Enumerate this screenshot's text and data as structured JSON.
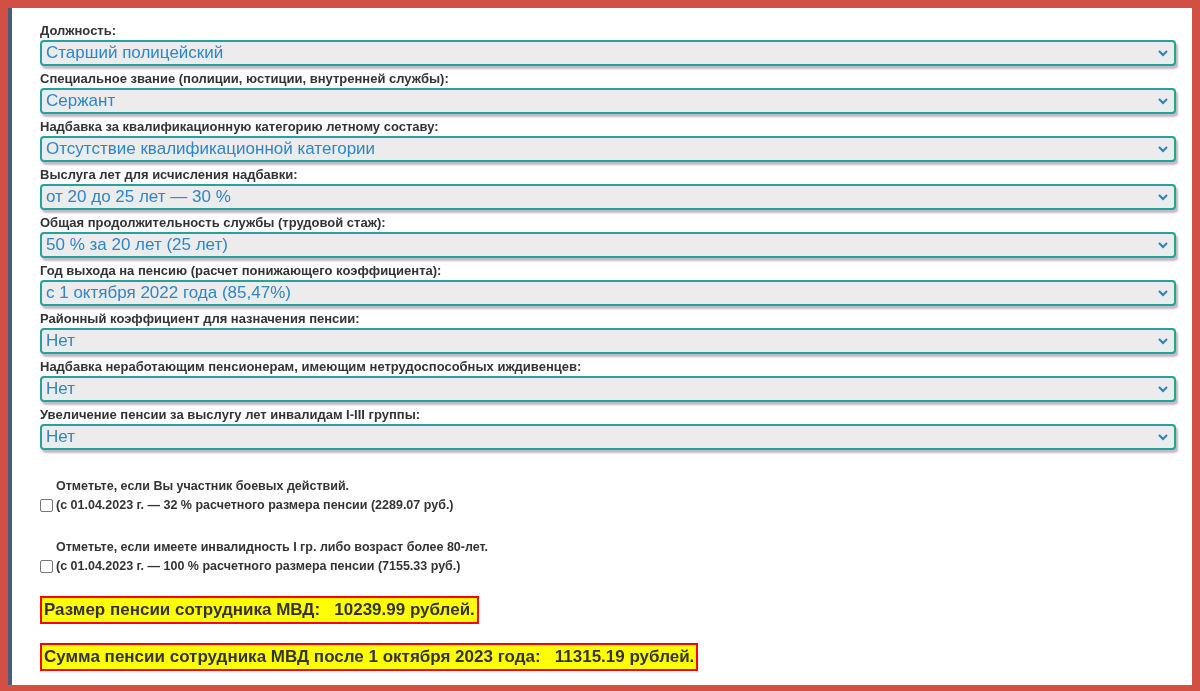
{
  "fields": [
    {
      "label": "Должность:",
      "value": "Старший полицейский"
    },
    {
      "label": "Специальное звание (полиции, юстиции, внутренней службы):",
      "value": "Сержант"
    },
    {
      "label": "Надбавка за квалификационную категорию летному составу:",
      "value": "Отсутствие квалификационной категории"
    },
    {
      "label": "Выслуга лет для исчисления надбавки:",
      "value": "от 20 до 25 лет — 30 %"
    },
    {
      "label": "Общая продолжительность службы (трудовой стаж):",
      "value": "50 % за 20 лет (25 лет)"
    },
    {
      "label": "Год выхода на пенсию (расчет понижающего коэффициента):",
      "value": "с 1 октября 2022 года (85,47%)"
    },
    {
      "label": "Районный коэффициент для назначения пенсии:",
      "value": "Нет"
    },
    {
      "label": "Надбавка неработающим пенсионерам, имеющим нетрудоспособных иждивенцев:",
      "value": "Нет"
    },
    {
      "label": "Увеличение пенсии за выслугу лет инвалидам I-III группы:",
      "value": "Нет"
    }
  ],
  "options": [
    {
      "title": "Отметьте, если Вы участник боевых действий.",
      "detail": "(с 01.04.2023 г. — 32 % расчетного размера пенсии (2289.07 руб.)",
      "checked": false
    },
    {
      "title": "Отметьте, если имеете инвалидность I гр. либо возраст более 80-лет.",
      "detail": "(с 01.04.2023 г. — 100 % расчетного размера пенсии (7155.33 руб.)",
      "checked": false
    }
  ],
  "results": [
    "Размер пенсии сотрудника МВД:   10239.99 рублей.",
    "Сумма пенсии сотрудника МВД после 1 октября 2023 года:   11315.19 рублей."
  ]
}
